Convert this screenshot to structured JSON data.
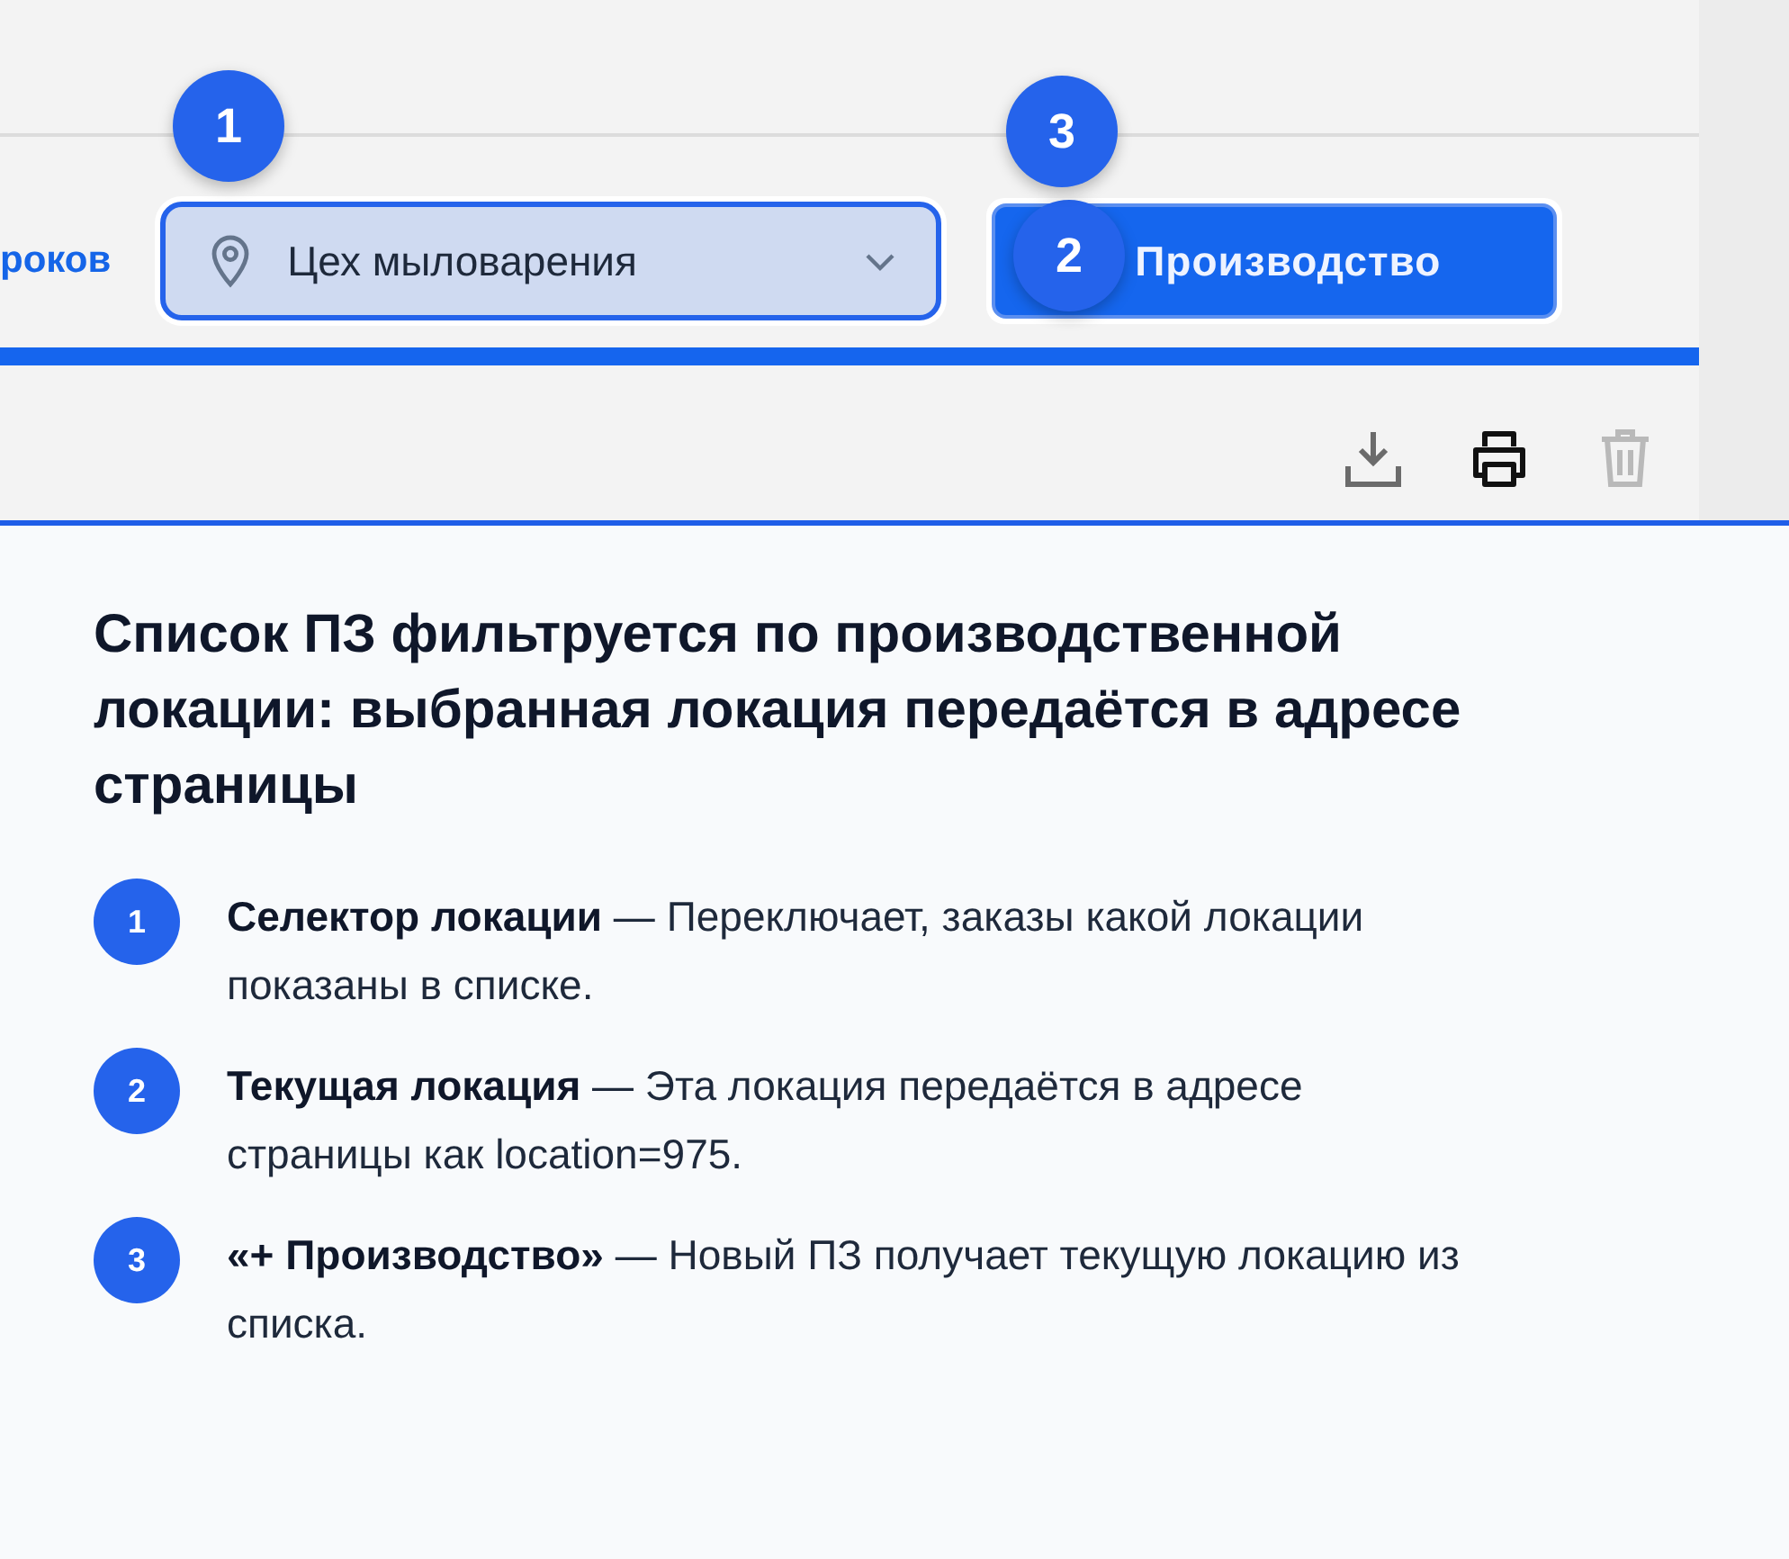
{
  "toolbar": {
    "link_text": "роков",
    "location_select": {
      "value": "Цех мыловарения"
    },
    "create_button": {
      "label": "Производство"
    }
  },
  "actions": [
    {
      "kind": "download",
      "disabled": false
    },
    {
      "kind": "print",
      "disabled": false
    },
    {
      "kind": "delete",
      "disabled": true
    }
  ],
  "callouts": [
    {
      "label": "1"
    },
    {
      "label": "2"
    },
    {
      "label": "3"
    }
  ],
  "explanation": {
    "title": "Список ПЗ фильтруется по производственной локации: выбранная локация передаётся в адресе страницы",
    "items": [
      {
        "number": "1",
        "text": "**Селектор локации** — Переключает, заказы какой локации показаны в списке."
      },
      {
        "number": "2",
        "text": "**Текущая локация** — Эта локация передаётся в адресе страницы как location=975."
      },
      {
        "number": "3",
        "text": "**«+ Производство»** — Новый ПЗ получает текущую локацию из списка."
      }
    ]
  }
}
